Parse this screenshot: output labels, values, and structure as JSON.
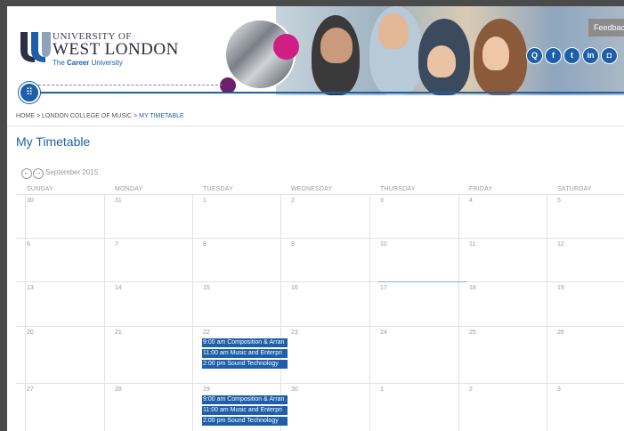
{
  "brand": {
    "line1": "UNIVERSITY OF",
    "line2": "WEST LONDON",
    "tagline_prefix": "The ",
    "tagline_bold": "Career",
    "tagline_suffix": " University"
  },
  "header": {
    "feedback_label": "Feedbac",
    "menu_icon": "grid-icon",
    "social": [
      {
        "name": "search-icon",
        "glyph": "Q"
      },
      {
        "name": "facebook-icon",
        "glyph": "f"
      },
      {
        "name": "twitter-icon",
        "glyph": "t"
      },
      {
        "name": "linkedin-icon",
        "glyph": "in"
      },
      {
        "name": "instagram-icon",
        "glyph": "◘"
      }
    ]
  },
  "breadcrumb": {
    "home": "HOME",
    "college": "LONDON COLLEGE OF MUSIC",
    "current": "MY TIMETABLE"
  },
  "page_title": "My Timetable",
  "calendar": {
    "month": "September 2015",
    "weekdays": [
      "SUNDAY",
      "MONDAY",
      "TUESDAY",
      "WEDNESDAY",
      "THURSDAY",
      "FRIDAY",
      "SATURDAY"
    ],
    "weeks": [
      [
        "30",
        "31",
        "1",
        "2",
        "3",
        "4",
        "5"
      ],
      [
        "6",
        "7",
        "8",
        "9",
        "10",
        "11",
        "12"
      ],
      [
        "13",
        "14",
        "15",
        "16",
        "17",
        "18",
        "19"
      ],
      [
        "20",
        "21",
        "22",
        "23",
        "24",
        "25",
        "26"
      ],
      [
        "27",
        "28",
        "29",
        "30",
        "1",
        "2",
        "3"
      ]
    ],
    "events_week4_tue": [
      "9:00 am Composition & Arran",
      "11:00 am Music and Enterpri",
      "2:00 pm Sound Technology"
    ],
    "events_week5_tue": [
      "9:00 am Composition & Arran",
      "11:00 am Music and Enterpri",
      "2:00 pm Sound Technology"
    ]
  },
  "colors": {
    "brand_blue": "#1d5fa8",
    "magenta": "#cf1f84",
    "purple": "#6d1f6b"
  }
}
